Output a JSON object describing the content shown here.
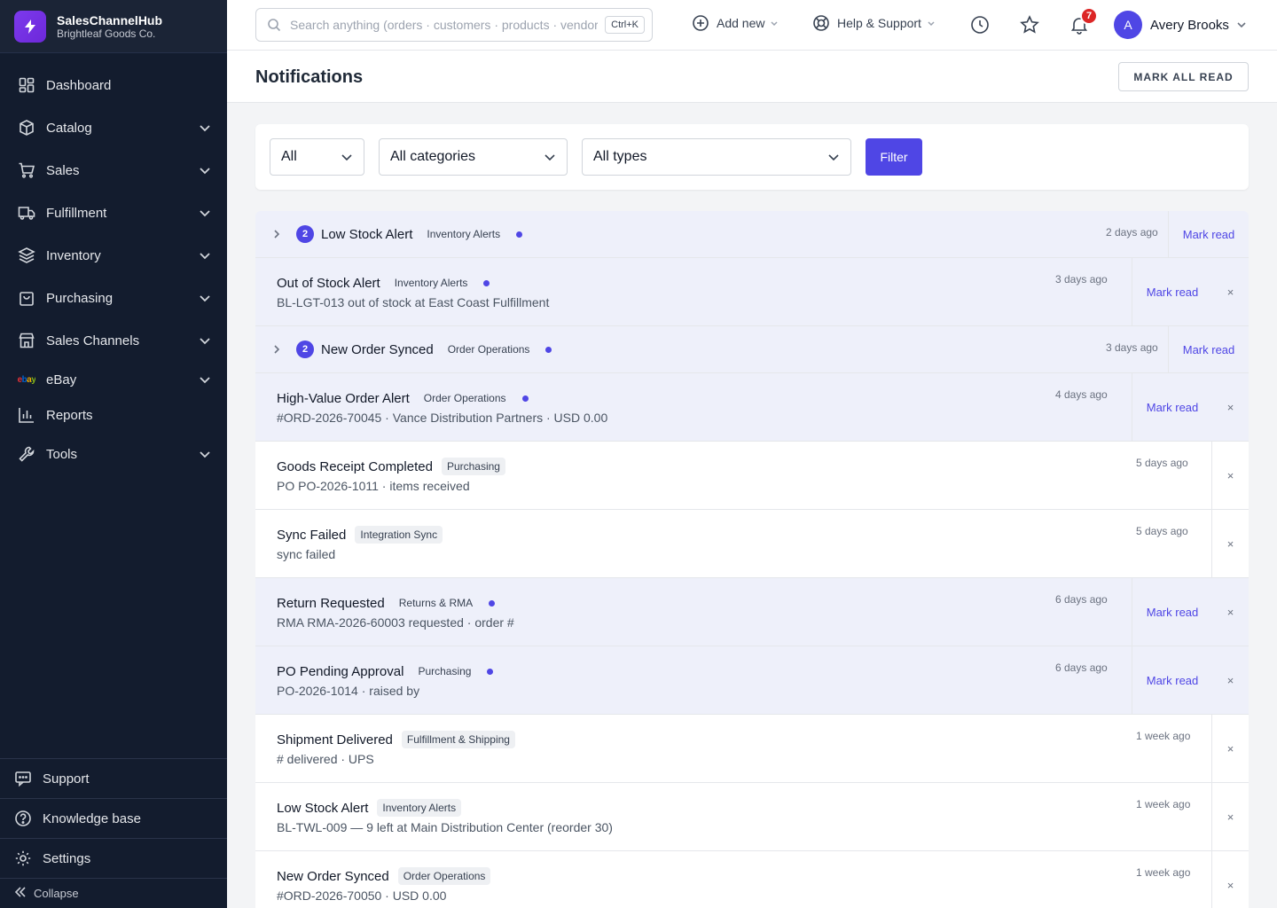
{
  "brand": {
    "name": "SalesChannelHub",
    "company": "Brightleaf Goods Co."
  },
  "sidebar": {
    "items": [
      {
        "label": "Dashboard",
        "icon": "dashboard-icon",
        "has_children": false
      },
      {
        "label": "Catalog",
        "icon": "box-icon",
        "has_children": true
      },
      {
        "label": "Sales",
        "icon": "cart-icon",
        "has_children": true
      },
      {
        "label": "Fulfillment",
        "icon": "truck-icon",
        "has_children": true
      },
      {
        "label": "Inventory",
        "icon": "layers-icon",
        "has_children": true
      },
      {
        "label": "Purchasing",
        "icon": "shopping-bag-icon",
        "has_children": true
      },
      {
        "label": "Sales Channels",
        "icon": "store-icon",
        "has_children": true
      },
      {
        "label": "eBay",
        "icon": "ebay-logo-icon",
        "has_children": true
      },
      {
        "label": "Reports",
        "icon": "bar-chart-icon",
        "has_children": false
      },
      {
        "label": "Tools",
        "icon": "wrench-icon",
        "has_children": true
      }
    ],
    "ebay_logo_text": "ebay",
    "bottom": {
      "support": "Support",
      "knowledge_base": "Knowledge base",
      "settings": "Settings",
      "collapse": "Collapse"
    }
  },
  "topbar": {
    "search_placeholder": "Search anything (orders · customers · products · vendors)",
    "search_shortcut": "Ctrl+K",
    "add_new": "Add new",
    "help": "Help & Support",
    "notifications_count": "7",
    "user": {
      "initial": "A",
      "name": "Avery Brooks"
    }
  },
  "page": {
    "title": "Notifications",
    "mark_all_read": "MARK ALL READ"
  },
  "filters": {
    "status": "All",
    "category": "All categories",
    "type": "All types",
    "button": "Filter"
  },
  "notifications": [
    {
      "kind": "group",
      "count": "2",
      "title": "Low Stock Alert",
      "tag": "Inventory Alerts",
      "time": "2 days ago",
      "unread": true,
      "action": "Mark read"
    },
    {
      "kind": "item",
      "title": "Out of Stock Alert",
      "tag": "Inventory Alerts",
      "desc": "BL-LGT-013 out of stock at East Coast Fulfillment",
      "time": "3 days ago",
      "unread": true,
      "action": "Mark read",
      "close": "×"
    },
    {
      "kind": "group",
      "count": "2",
      "title": "New Order Synced",
      "tag": "Order Operations",
      "time": "3 days ago",
      "unread": true,
      "action": "Mark read"
    },
    {
      "kind": "item",
      "title": "High-Value Order Alert",
      "tag": "Order Operations",
      "desc": "#ORD-2026-70045 · Vance Distribution Partners · USD 0.00",
      "time": "4 days ago",
      "unread": true,
      "action": "Mark read",
      "close": "×"
    },
    {
      "kind": "item",
      "title": "Goods Receipt Completed",
      "tag": "Purchasing",
      "desc": "PO PO-2026-1011 · items received",
      "time": "5 days ago",
      "unread": false,
      "close": "×"
    },
    {
      "kind": "item",
      "title": "Sync Failed",
      "tag": "Integration Sync",
      "desc": "sync failed",
      "time": "5 days ago",
      "unread": false,
      "close": "×"
    },
    {
      "kind": "item",
      "title": "Return Requested",
      "tag": "Returns & RMA",
      "desc": "RMA RMA-2026-60003 requested · order #",
      "time": "6 days ago",
      "unread": true,
      "action": "Mark read",
      "close": "×"
    },
    {
      "kind": "item",
      "title": "PO Pending Approval",
      "tag": "Purchasing",
      "desc": "PO-2026-1014 · raised by",
      "time": "6 days ago",
      "unread": true,
      "action": "Mark read",
      "close": "×"
    },
    {
      "kind": "item",
      "title": "Shipment Delivered",
      "tag": "Fulfillment & Shipping",
      "desc": "# delivered · UPS",
      "time": "1 week ago",
      "unread": false,
      "close": "×"
    },
    {
      "kind": "item",
      "title": "Low Stock Alert",
      "tag": "Inventory Alerts",
      "desc": "BL-TWL-009 — 9 left at Main Distribution Center (reorder 30)",
      "time": "1 week ago",
      "unread": false,
      "close": "×"
    },
    {
      "kind": "item",
      "title": "New Order Synced",
      "tag": "Order Operations",
      "desc": "#ORD-2026-70050 · USD 0.00",
      "time": "1 week ago",
      "unread": false,
      "close": "×"
    }
  ],
  "colors": {
    "accent": "#4f46e5",
    "sidebar_bg": "#131c2e",
    "unread_bg": "#eef0fa",
    "badge_red": "#dc2626"
  }
}
